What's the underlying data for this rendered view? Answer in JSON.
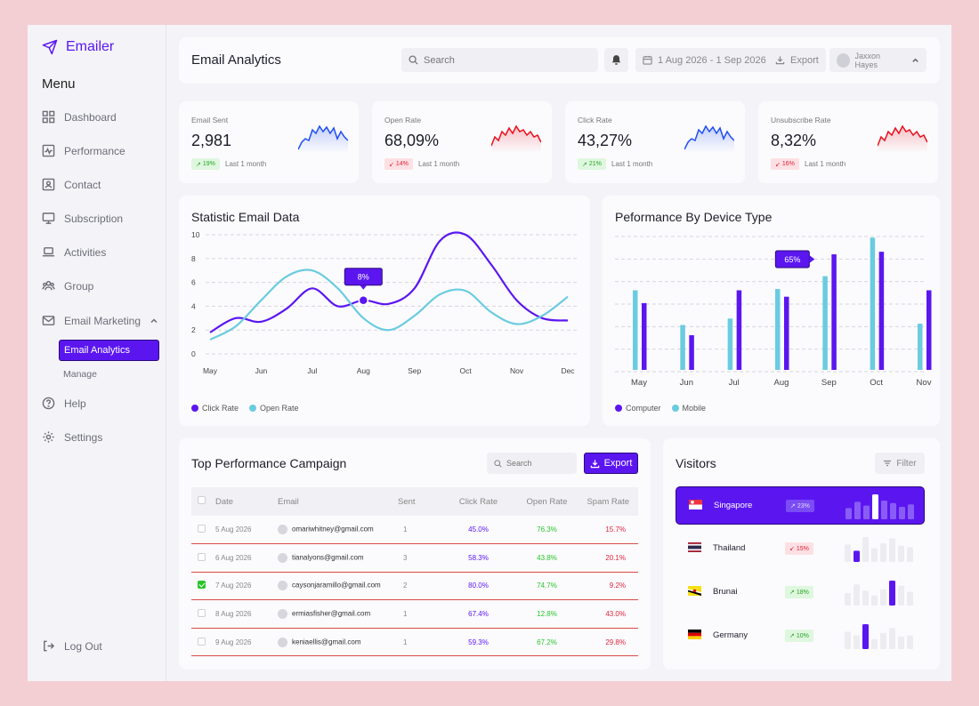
{
  "app": {
    "name": "Emailer"
  },
  "sidebar": {
    "menu_heading": "Menu",
    "items": [
      {
        "label": "Dashboard",
        "icon": "grid-icon"
      },
      {
        "label": "Performance",
        "icon": "activity-icon"
      },
      {
        "label": "Contact",
        "icon": "contact-icon"
      },
      {
        "label": "Subscription",
        "icon": "monitor-icon"
      },
      {
        "label": "Activities",
        "icon": "laptop-icon"
      },
      {
        "label": "Group",
        "icon": "users-icon"
      },
      {
        "label": "Email Marketing",
        "icon": "mail-icon"
      },
      {
        "label": "Help",
        "icon": "help-icon"
      },
      {
        "label": "Settings",
        "icon": "gear-icon"
      }
    ],
    "sub_items": [
      "Email Analytics",
      "Manage"
    ],
    "logout": "Log Out"
  },
  "header": {
    "title": "Email Analytics",
    "search_placeholder": "Search",
    "date_range": "1 Aug 2026 - 1 Sep 2026",
    "export": "Export",
    "user": "Jaxxon Hayes"
  },
  "stats": [
    {
      "label": "Email Sent",
      "value": "2,981",
      "change": "19%",
      "trend": "up",
      "period": "Last 1 month",
      "color": "#1f4ef0"
    },
    {
      "label": "Open Rate",
      "value": "68,09%",
      "change": "14%",
      "trend": "down",
      "period": "Last 1 month",
      "color": "#e8101c"
    },
    {
      "label": "Click Rate",
      "value": "43,27%",
      "change": "21%",
      "trend": "up",
      "period": "Last 1 month",
      "color": "#1f4ef0"
    },
    {
      "label": "Unsubscribe Rate",
      "value": "8,32%",
      "change": "16%",
      "trend": "down",
      "period": "Last 1 month",
      "color": "#e8101c"
    }
  ],
  "statistic_panel": {
    "title": "Statistic Email Data",
    "tooltip": "8%"
  },
  "device_panel": {
    "title": "Peformance By Device Type",
    "tooltip": "65%"
  },
  "chart_data": [
    {
      "type": "line",
      "title": "Statistic Email Data",
      "x": [
        "May",
        "Jun",
        "Jul",
        "Aug",
        "Sep",
        "Oct",
        "Nov",
        "Dec"
      ],
      "ylim": [
        0,
        10
      ],
      "yticks": [
        0,
        2,
        4,
        6,
        8,
        10
      ],
      "series": [
        {
          "name": "Click Rate",
          "color": "#5b16f0",
          "points": [
            [
              0,
              1.8
            ],
            [
              0.5,
              3.0
            ],
            [
              1.0,
              2.7
            ],
            [
              1.5,
              3.8
            ],
            [
              2.0,
              5.5
            ],
            [
              2.5,
              4.0
            ],
            [
              3.0,
              4.5
            ],
            [
              3.5,
              4.2
            ],
            [
              4.0,
              5.5
            ],
            [
              4.5,
              9.5
            ],
            [
              5.0,
              10.0
            ],
            [
              5.5,
              7.5
            ],
            [
              6.0,
              4.5
            ],
            [
              6.5,
              3.0
            ],
            [
              7.0,
              2.8
            ]
          ]
        },
        {
          "name": "Open Rate",
          "color": "#6bcbe0",
          "points": [
            [
              0,
              1.2
            ],
            [
              0.5,
              2.3
            ],
            [
              1.0,
              4.5
            ],
            [
              1.5,
              6.5
            ],
            [
              2.0,
              7.0
            ],
            [
              2.5,
              5.5
            ],
            [
              3.0,
              3.0
            ],
            [
              3.5,
              2.0
            ],
            [
              4.0,
              3.2
            ],
            [
              4.5,
              5.0
            ],
            [
              5.0,
              5.3
            ],
            [
              5.5,
              3.5
            ],
            [
              6.0,
              2.5
            ],
            [
              6.5,
              3.2
            ],
            [
              7.0,
              4.8
            ]
          ]
        }
      ],
      "annotation": {
        "x": 3,
        "label": "8%"
      },
      "grid": true,
      "legend": "bottom-left"
    },
    {
      "type": "bar",
      "title": "Peformance By Device Type",
      "categories": [
        "May",
        "Jun",
        "Jul",
        "Aug",
        "Sep",
        "Oct",
        "Nov"
      ],
      "ylim": [
        0,
        100
      ],
      "series": [
        {
          "name": "Computer",
          "color": "#5b16f0",
          "values": [
            52,
            27,
            62,
            57,
            90,
            92,
            62
          ]
        },
        {
          "name": "Mobile",
          "color": "#6bcbe0",
          "values": [
            62,
            35,
            40,
            63,
            73,
            103,
            36
          ]
        }
      ],
      "annotation": {
        "category": "Sep",
        "label": "65%"
      },
      "grid": true,
      "legend": "bottom-left"
    }
  ],
  "campaign": {
    "title": "Top Performance Campaign",
    "search_placeholder": "Search",
    "export": "Export",
    "columns": [
      "Date",
      "Email",
      "Sent",
      "Click Rate",
      "Open Rate",
      "Spam Rate"
    ],
    "rows": [
      {
        "checked": false,
        "date": "5 Aug 2026",
        "email": "omariwhitney@gmail.com",
        "sent": "1",
        "click": "45.0%",
        "open": "76.3%",
        "spam": "15.7%"
      },
      {
        "checked": false,
        "date": "6 Aug 2026",
        "email": "tianalyons@gmail.com",
        "sent": "3",
        "click": "58.3%",
        "open": "43.8%",
        "spam": "20.1%"
      },
      {
        "checked": true,
        "date": "7 Aug 2026",
        "email": "caysonjaramillo@gmail.com",
        "sent": "2",
        "click": "80.0%",
        "open": "74.7%",
        "spam": "9.2%"
      },
      {
        "checked": false,
        "date": "8 Aug 2026",
        "email": "ermiasfisher@gmail.com",
        "sent": "1",
        "click": "67.4%",
        "open": "12.8%",
        "spam": "43.0%"
      },
      {
        "checked": false,
        "date": "9 Aug 2026",
        "email": "keniaellis@gmail.com",
        "sent": "1",
        "click": "59.3%",
        "open": "67.2%",
        "spam": "29.8%"
      }
    ]
  },
  "visitors": {
    "title": "Visitors",
    "filter": "Filter",
    "rows": [
      {
        "country": "Singapore",
        "change": "23%",
        "trend": "up",
        "active": true,
        "flag": "sg",
        "bars": [
          0.45,
          0.7,
          0.55,
          1.0,
          0.75,
          0.65,
          0.5,
          0.6
        ],
        "highlight": 3
      },
      {
        "country": "Thailand",
        "change": "15%",
        "trend": "down",
        "active": false,
        "flag": "th",
        "bars": [
          0.7,
          0.45,
          1.0,
          0.55,
          0.75,
          0.95,
          0.65,
          0.6
        ],
        "highlight": 1
      },
      {
        "country": "Brunai",
        "change": "18%",
        "trend": "up",
        "active": false,
        "flag": "bn",
        "bars": [
          0.5,
          0.85,
          0.6,
          0.4,
          0.65,
          1.0,
          0.8,
          0.55
        ],
        "highlight": 5
      },
      {
        "country": "Germany",
        "change": "10%",
        "trend": "up",
        "active": false,
        "flag": "de",
        "bars": [
          0.7,
          0.55,
          1.0,
          0.4,
          0.65,
          0.85,
          0.5,
          0.55
        ],
        "highlight": 2
      }
    ]
  }
}
